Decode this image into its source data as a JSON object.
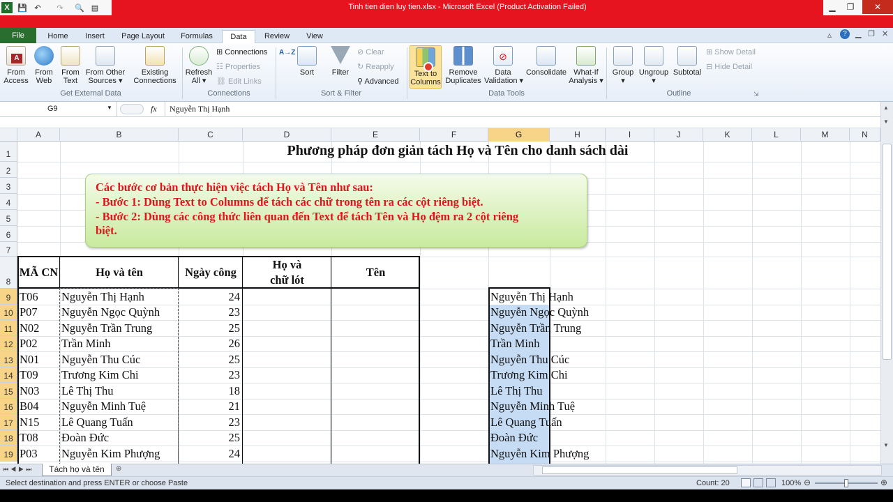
{
  "window": {
    "title": "Tinh tien dien luy tien.xlsx  -  Microsoft Excel (Product Activation Failed)"
  },
  "tabs": [
    "File",
    "Home",
    "Insert",
    "Page Layout",
    "Formulas",
    "Data",
    "Review",
    "View"
  ],
  "ribbon": {
    "get_external": {
      "from_access": "From\nAccess",
      "from_web": "From\nWeb",
      "from_text": "From\nText",
      "from_other": "From Other\nSources ▾",
      "existing": "Existing\nConnections",
      "label": "Get External Data"
    },
    "connections": {
      "refresh": "Refresh\nAll ▾",
      "connections": "Connections",
      "properties": "Properties",
      "edit_links": "Edit Links",
      "label": "Connections"
    },
    "sort_filter": {
      "sort_az": "A→Z",
      "sort": "Sort",
      "filter": "Filter",
      "clear": "Clear",
      "reapply": "Reapply",
      "advanced": "Advanced",
      "label": "Sort & Filter"
    },
    "data_tools": {
      "text_to_columns": "Text to\nColumns",
      "remove_dup": "Remove\nDuplicates",
      "validation": "Data\nValidation ▾",
      "consolidate": "Consolidate",
      "whatif": "What-If\nAnalysis ▾",
      "label": "Data Tools"
    },
    "outline": {
      "group": "Group\n▾",
      "ungroup": "Ungroup\n▾",
      "subtotal": "Subtotal",
      "show_detail": "Show Detail",
      "hide_detail": "Hide Detail",
      "label": "Outline"
    }
  },
  "formula_bar": {
    "name_box": "G9",
    "fx": "fx",
    "content": "Nguyễn Thị Hạnh"
  },
  "columns": [
    "A",
    "B",
    "C",
    "D",
    "E",
    "F",
    "G",
    "H",
    "I",
    "J",
    "K",
    "L",
    "M",
    "N"
  ],
  "rows": [
    "1",
    "2",
    "3",
    "4",
    "5",
    "6",
    "7",
    "8",
    "9",
    "10",
    "11",
    "12",
    "13",
    "14",
    "15",
    "16",
    "17",
    "18",
    "19"
  ],
  "sheet": {
    "title": "Phương pháp đơn giản tách Họ và Tên cho danh sách dài",
    "note": {
      "line1": "Các bước cơ bản thực hiện việc tách Họ và Tên như sau:",
      "line2": "- Bước 1: Dùng Text to Columns để tách các chữ trong tên ra các cột riêng biệt.",
      "line3": "- Bước 2: Dùng các công thức liên quan đến Text để tách Tên và Họ đệm ra 2  cột riêng",
      "line4": "biệt."
    },
    "headers": {
      "ma": "MÃ CN",
      "hoten": "Họ và tên",
      "ngay": "Ngày công",
      "holot1": "Họ và",
      "holot2": "chữ lót",
      "ten": "Tên"
    },
    "table": [
      {
        "ma": "T06",
        "name": "Nguyễn Thị Hạnh",
        "days": "24"
      },
      {
        "ma": "P07",
        "name": "Nguyễn Ngọc Quỳnh",
        "days": "23"
      },
      {
        "ma": "N02",
        "name": "Nguyễn Trần Trung",
        "days": "25"
      },
      {
        "ma": "P02",
        "name": "Trần Minh",
        "days": "26"
      },
      {
        "ma": "N01",
        "name": "Nguyễn Thu Cúc",
        "days": "25"
      },
      {
        "ma": "T09",
        "name": "Trương Kim Chi",
        "days": "23"
      },
      {
        "ma": "N03",
        "name": "Lê Thị Thu",
        "days": "18"
      },
      {
        "ma": "B04",
        "name": "Nguyễn Minh Tuệ",
        "days": "21"
      },
      {
        "ma": "N15",
        "name": "Lê Quang Tuấn",
        "days": "23"
      },
      {
        "ma": "T08",
        "name": "Đoàn Đức",
        "days": "25"
      },
      {
        "ma": "P03",
        "name": "Nguyễn Kim Phượng",
        "days": "24"
      }
    ]
  },
  "sheet_tab": "Tách họ và tên",
  "status": {
    "message": "Select destination and press ENTER or choose Paste",
    "count": "Count: 20",
    "zoom": "100%"
  },
  "colors": {
    "title_red": "#e6141e",
    "file_green": "#2a6e2f",
    "note_red": "#e0141c",
    "selection_blue": "#c6dcf5",
    "header_selected": "#f8d488"
  }
}
